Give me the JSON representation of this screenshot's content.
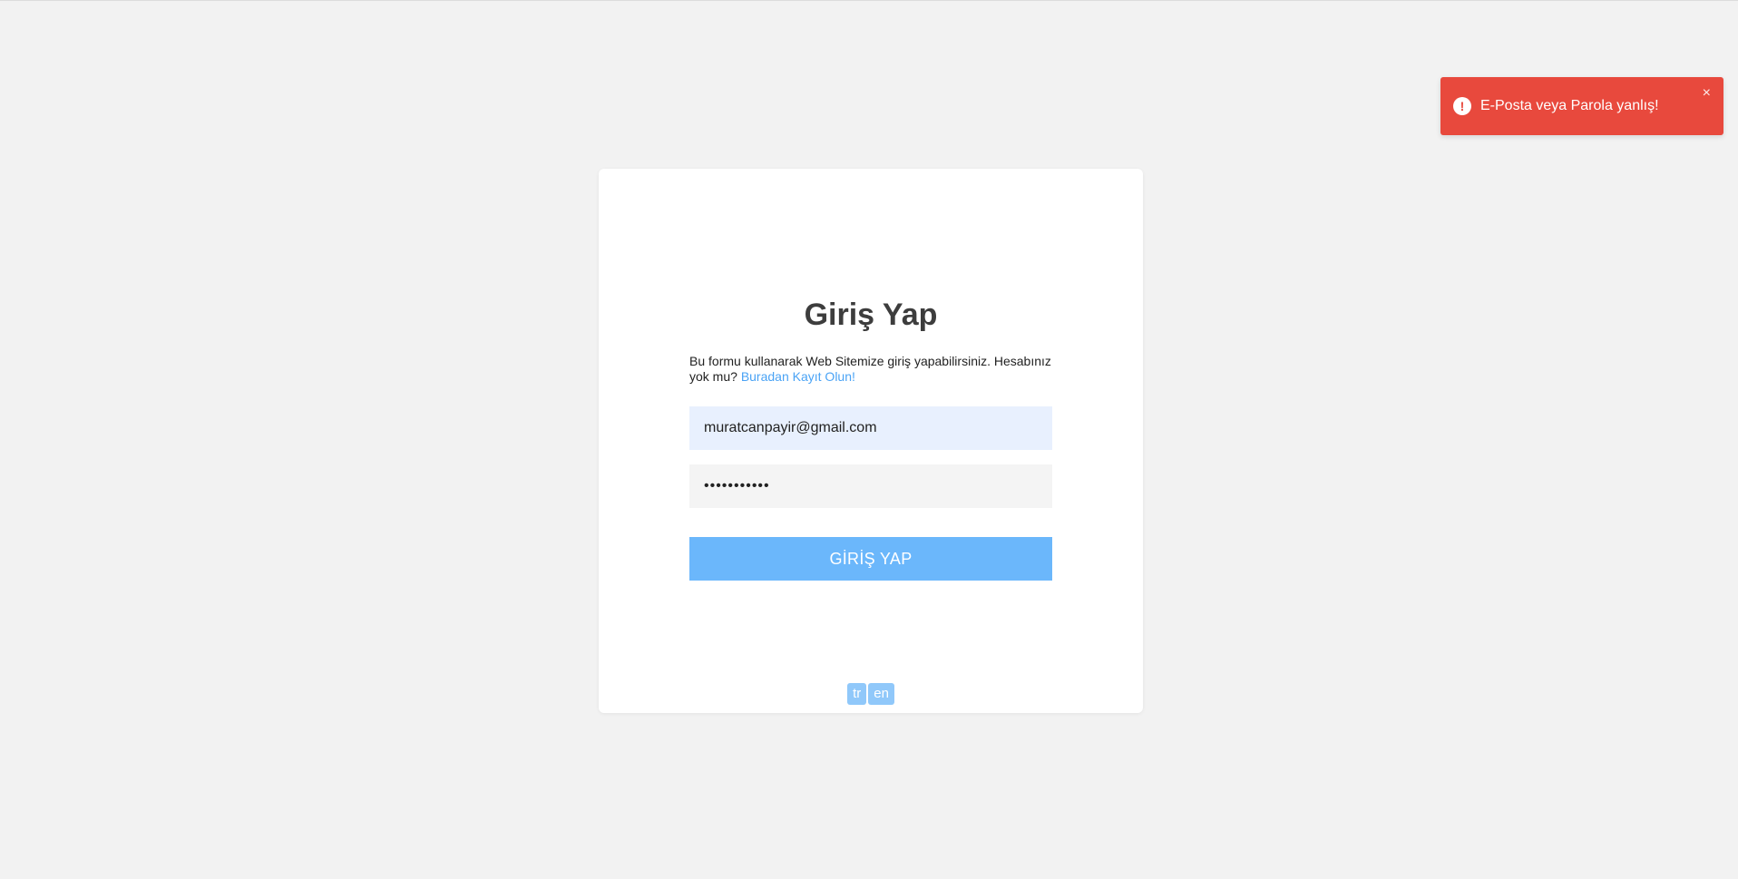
{
  "login": {
    "title": "Giriş Yap",
    "description": "Bu formu kullanarak Web Sitemize giriş yapabilirsiniz. Hesabınız yok mu?",
    "register_link": "Buradan Kayıt Olun!",
    "email_value": "muratcanpayir@gmail.com",
    "password_value": "•••••••••••",
    "submit_label": "GİRİŞ YAP"
  },
  "languages": [
    "tr",
    "en"
  ],
  "toast": {
    "message": "E-Posta veya Parola yanlış!",
    "icon": "alert-circle-icon",
    "close": "×",
    "color": "#e8493d"
  },
  "colors": {
    "background": "#f2f2f2",
    "primary": "#6bb7fb",
    "link": "#4aa3f5",
    "email_fill": "#e8f0fe"
  }
}
